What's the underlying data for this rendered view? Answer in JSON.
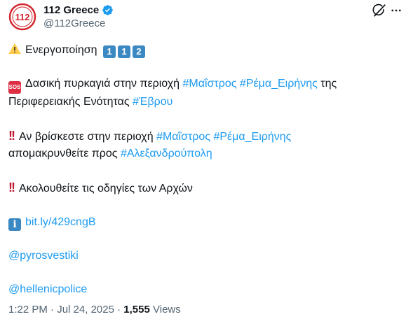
{
  "author": {
    "display_name": "112 Greece",
    "handle": "@112Greece",
    "avatar_text": "112",
    "avatar_color": "#d3262e",
    "verified_color": "#1d9bf0"
  },
  "icons": {
    "grok": "grok-icon",
    "more": "more-icon"
  },
  "tweet": {
    "line1": {
      "text": "Ενεργοποίηση",
      "keycaps": [
        "1",
        "1",
        "2"
      ]
    },
    "line2": {
      "sos": "SOS",
      "before": "Δασική πυρκαγιά στην περιοχή",
      "tag1": "#Μαΐστρος",
      "tag2": "#Ρέμα_Ειρήνης",
      "mid": "της",
      "second_line": "Περιφερειακής Ενότητας",
      "tag3": "#Έβρου"
    },
    "line3": {
      "before": "Αν βρίσκεστε στην περιοχή",
      "tag1": "#Μαΐστρος",
      "tag2": "#Ρέμα_Ειρήνης",
      "second_line": "απομακρυνθείτε προς",
      "tag3": "#Αλεξανδρούπολη"
    },
    "line4": {
      "text": "Ακολουθείτε τις οδηγίες των Αρχών"
    },
    "line5": {
      "info": "i",
      "link": "bit.ly/429cngB"
    },
    "mention1": "@pyrosvestiki",
    "mention2": "@hellenicpolice"
  },
  "meta": {
    "time": "1:22 PM",
    "separator": "·",
    "date": "Jul 24, 2025",
    "views_count": "1,555",
    "views_label": "Views"
  }
}
